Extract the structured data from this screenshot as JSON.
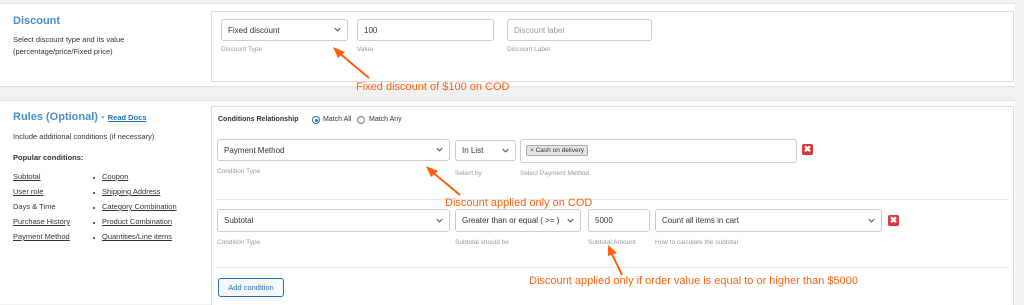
{
  "discount": {
    "heading": "Discount",
    "description_line1": "Select discount type and its value",
    "description_line2": "(percentage/price/Fixed price)",
    "type_value": "Fixed discount",
    "type_caption": "Discount Type",
    "value": "100",
    "value_caption": "Value",
    "label_placeholder": "Discount label",
    "label_caption": "Discount Label"
  },
  "rules": {
    "heading": "Rules (Optional)",
    "heading_dash": "-",
    "read_docs": "Read Docs",
    "description": "Include additional conditions (if necessary)",
    "popular_heading": "Popular conditions:",
    "popular_left": [
      "Subtotal",
      "User role",
      "Days & Time",
      "Purchase History",
      "Payment Method"
    ],
    "popular_right": [
      "Coupon",
      "Shipping Address",
      "Category Combination",
      "Product Combination",
      "Quantities/Line items"
    ],
    "relationship_label": "Conditions Relationship",
    "match_all": "Match All",
    "match_any": "Match Any",
    "condition1": {
      "type": "Payment Method",
      "type_caption": "Condition Type",
      "operator": "In List",
      "operator_caption": "Select by",
      "tag": "Cash on delivery",
      "value_caption": "Select Payment Method"
    },
    "condition2": {
      "type": "Subtotal",
      "type_caption": "Condition Type",
      "operator": "Greater than or equal ( >= )",
      "operator_caption": "Subtotal should be",
      "amount": "5000",
      "amount_caption": "Subtotal Amount",
      "calc": "Count all items in cart",
      "calc_caption": "How to calculate the subtotal"
    },
    "add_condition": "Add condition",
    "delete_glyph": "✖"
  },
  "annotations": {
    "fixed_discount": "Fixed discount of $100 on COD",
    "cod_only": "Discount applied only on COD",
    "order_value": "Discount applied only if order value is equal to or higher than $5000"
  },
  "colors": {
    "heading": "#4a90c8",
    "annotation": "#ff5f0a",
    "delete": "#d9363e",
    "primary": "#2271b1"
  },
  "icons": {
    "dropdown": "chevron-down-icon",
    "delete": "close-icon",
    "arrow": "arrow-icon",
    "radio": "radio-icon"
  }
}
